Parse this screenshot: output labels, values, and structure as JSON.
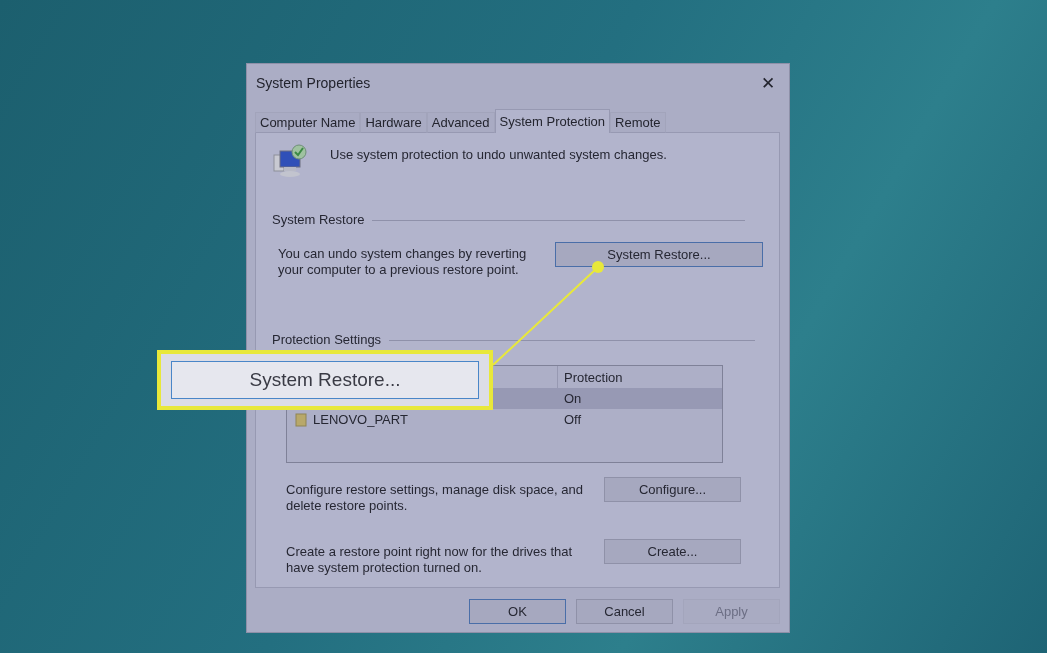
{
  "window": {
    "title": "System Properties",
    "close": "✕"
  },
  "tabs": [
    {
      "label": "Computer Name",
      "selected": false
    },
    {
      "label": "Hardware",
      "selected": false
    },
    {
      "label": "Advanced",
      "selected": false
    },
    {
      "label": "System Protection",
      "selected": true
    },
    {
      "label": "Remote",
      "selected": false
    }
  ],
  "intro": "Use system protection to undo unwanted system changes.",
  "system_restore": {
    "title": "System Restore",
    "text": "You can undo system changes by reverting your computer to a previous restore point.",
    "button": {
      "label": "System Restore...",
      "focused": true,
      "disabled": false
    }
  },
  "protection_settings": {
    "title": "Protection Settings",
    "columns": [
      {
        "label": "Protection"
      }
    ],
    "rows": [
      {
        "protection": "On",
        "selected": true
      },
      {
        "name": "LENOVO_PART",
        "protection": "Off",
        "selected": false
      }
    ]
  },
  "actions": [
    {
      "text": "Configure restore settings, manage disk space, and delete restore points.",
      "button": {
        "label": "Configure...",
        "focused": false,
        "disabled": false
      }
    },
    {
      "text": "Create a restore point right now for the drives that have system protection turned on.",
      "button": {
        "label": "Create...",
        "focused": false,
        "disabled": false
      }
    }
  ],
  "footer": [
    {
      "label": "OK",
      "focused": true,
      "disabled": false
    },
    {
      "label": "Cancel",
      "focused": false,
      "disabled": false
    },
    {
      "label": "Apply",
      "focused": false,
      "disabled": true
    }
  ],
  "callout": {
    "label": "System Restore..."
  }
}
